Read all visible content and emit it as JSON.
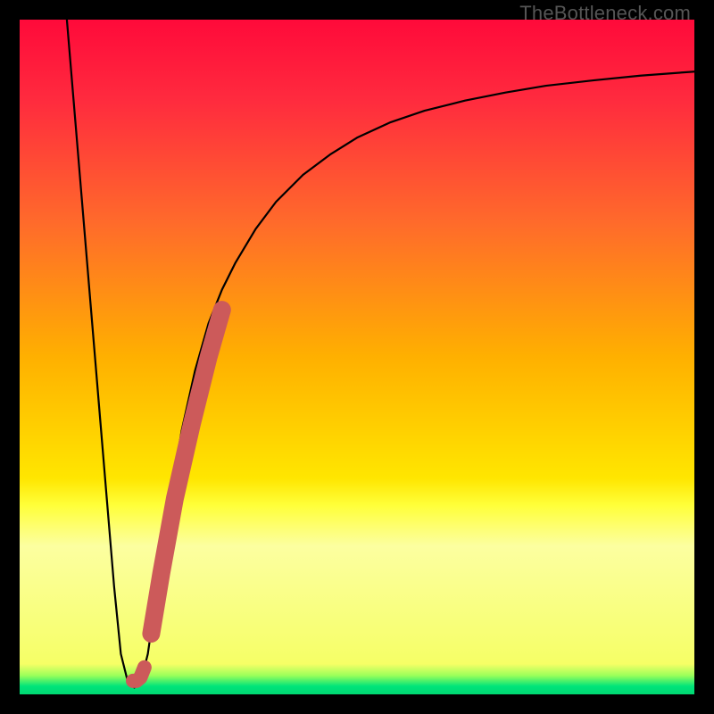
{
  "watermark": "TheBottleneck.com",
  "chart_data": {
    "type": "line",
    "title": "",
    "xlabel": "",
    "ylabel": "",
    "xlim": [
      0,
      100
    ],
    "ylim": [
      0,
      100
    ],
    "gradient_stops": [
      {
        "pos": 0.0,
        "color": "#ff0a3a"
      },
      {
        "pos": 0.12,
        "color": "#ff2b3e"
      },
      {
        "pos": 0.3,
        "color": "#ff6a2b"
      },
      {
        "pos": 0.5,
        "color": "#ffb000"
      },
      {
        "pos": 0.68,
        "color": "#ffe600"
      },
      {
        "pos": 0.72,
        "color": "#ffff3a"
      },
      {
        "pos": 0.78,
        "color": "#fcffa0"
      },
      {
        "pos": 0.955,
        "color": "#f6ff66"
      },
      {
        "pos": 0.972,
        "color": "#9bff5a"
      },
      {
        "pos": 0.988,
        "color": "#00e47a"
      },
      {
        "pos": 1.0,
        "color": "#00d872"
      }
    ],
    "series": [
      {
        "name": "bottleneck-curve",
        "color": "#000000",
        "x": [
          7,
          8,
          9,
          10,
          11,
          12,
          13,
          14,
          15,
          16,
          17,
          18,
          19,
          20,
          21,
          22,
          23,
          24,
          26,
          28,
          30,
          32,
          35,
          38,
          42,
          46,
          50,
          55,
          60,
          66,
          72,
          78,
          85,
          92,
          100
        ],
        "y": [
          100,
          88,
          76,
          64,
          52,
          40,
          28,
          16,
          6,
          2,
          1,
          2,
          6,
          13,
          20,
          27,
          33,
          39,
          48,
          55,
          60,
          64,
          69,
          73,
          77,
          80,
          82.5,
          84.8,
          86.5,
          88,
          89.2,
          90.2,
          91,
          91.7,
          92.3
        ]
      }
    ],
    "highlight_segments": [
      {
        "name": "segment-low",
        "color": "#cc5a5a",
        "width": 16,
        "x": [
          16.8,
          17.3,
          17.9,
          18.5
        ],
        "y": [
          2.0,
          2.0,
          2.5,
          4.0
        ]
      },
      {
        "name": "segment-rise",
        "color": "#cc5a5a",
        "width": 20,
        "x": [
          19.5,
          21.0,
          23.0,
          25.5,
          28.0,
          30.0
        ],
        "y": [
          9,
          18,
          29,
          40,
          50,
          57
        ]
      }
    ]
  }
}
